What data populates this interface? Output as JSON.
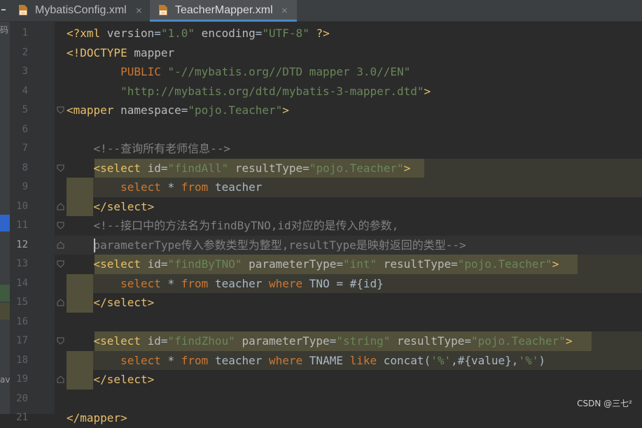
{
  "tabs": [
    {
      "label": "MybatisConfig.xml",
      "active": false,
      "close": "×"
    },
    {
      "label": "TeacherMapper.xml",
      "active": true,
      "close": "×"
    }
  ],
  "left_strip": {
    "text_top": "码",
    "text_bottom": "av"
  },
  "current_line": 12,
  "lines": [
    {
      "n": "1",
      "tokens": [
        [
          "tag",
          "<?xml "
        ],
        [
          "attr",
          "version"
        ],
        [
          "text",
          "="
        ],
        [
          "val",
          "\"1.0\""
        ],
        [
          "attr",
          " encoding"
        ],
        [
          "text",
          "="
        ],
        [
          "val",
          "\"UTF-8\""
        ],
        [
          "tag",
          " ?>"
        ]
      ]
    },
    {
      "n": "2",
      "tokens": [
        [
          "tag",
          "<!DOCTYPE "
        ],
        [
          "attr",
          "mapper"
        ]
      ]
    },
    {
      "n": "3",
      "tokens": [
        [
          "text",
          "        "
        ],
        [
          "pub",
          "PUBLIC "
        ],
        [
          "val",
          "\"-//mybatis.org//DTD mapper 3.0//EN\""
        ]
      ]
    },
    {
      "n": "4",
      "tokens": [
        [
          "text",
          "        "
        ],
        [
          "val",
          "\"http://mybatis.org/dtd/mybatis-3-mapper.dtd\""
        ],
        [
          "tag",
          ">"
        ]
      ]
    },
    {
      "n": "5",
      "tokens": [
        [
          "tag",
          "<mapper "
        ],
        [
          "attr",
          "namespace"
        ],
        [
          "text",
          "="
        ],
        [
          "val",
          "\"pojo.Teacher\""
        ],
        [
          "tag",
          ">"
        ]
      ]
    },
    {
      "n": "6",
      "tokens": []
    },
    {
      "n": "7",
      "tokens": [
        [
          "text",
          "    "
        ],
        [
          "com",
          "<!--查询所有老师信息-->"
        ]
      ]
    },
    {
      "n": "8",
      "tokens": [
        [
          "text",
          "    "
        ],
        [
          "tag",
          "<select "
        ],
        [
          "attr",
          "id"
        ],
        [
          "text",
          "="
        ],
        [
          "val",
          "\"findAll\""
        ],
        [
          "attr",
          " resultType"
        ],
        [
          "text",
          "="
        ],
        [
          "val",
          "\"pojo.Teacher\""
        ],
        [
          "tag",
          ">"
        ]
      ]
    },
    {
      "n": "9",
      "tokens": [
        [
          "text",
          "        "
        ],
        [
          "kw",
          "select "
        ],
        [
          "text",
          "* "
        ],
        [
          "kw",
          "from "
        ],
        [
          "text",
          "teacher"
        ]
      ]
    },
    {
      "n": "10",
      "tokens": [
        [
          "text",
          "    "
        ],
        [
          "tag",
          "</select>"
        ]
      ]
    },
    {
      "n": "11",
      "tokens": [
        [
          "text",
          "    "
        ],
        [
          "com",
          "<!--接口中的方法名为findByTNO,id对应的是传入的参数,"
        ]
      ]
    },
    {
      "n": "12",
      "tokens": [
        [
          "text",
          "    "
        ],
        [
          "com",
          "parameterType传入参数类型为整型,resultType是映射返回的类型-->"
        ]
      ]
    },
    {
      "n": "13",
      "tokens": [
        [
          "text",
          "    "
        ],
        [
          "tag",
          "<select "
        ],
        [
          "attr",
          "id"
        ],
        [
          "text",
          "="
        ],
        [
          "val",
          "\"findByTNO\""
        ],
        [
          "attr",
          " parameterType"
        ],
        [
          "text",
          "="
        ],
        [
          "val",
          "\"int\""
        ],
        [
          "attr",
          " resultType"
        ],
        [
          "text",
          "="
        ],
        [
          "val",
          "\"pojo.Teacher\""
        ],
        [
          "tag",
          ">"
        ]
      ]
    },
    {
      "n": "14",
      "tokens": [
        [
          "text",
          "        "
        ],
        [
          "kw",
          "select "
        ],
        [
          "text",
          "* "
        ],
        [
          "kw",
          "from "
        ],
        [
          "text",
          "teacher "
        ],
        [
          "kw",
          "where "
        ],
        [
          "text",
          "TNO = #{id}"
        ]
      ]
    },
    {
      "n": "15",
      "tokens": [
        [
          "text",
          "    "
        ],
        [
          "tag",
          "</select>"
        ]
      ]
    },
    {
      "n": "16",
      "tokens": []
    },
    {
      "n": "17",
      "tokens": [
        [
          "text",
          "    "
        ],
        [
          "tag",
          "<select "
        ],
        [
          "attr",
          "id"
        ],
        [
          "text",
          "="
        ],
        [
          "val",
          "\"findZhou\""
        ],
        [
          "attr",
          " parameterType"
        ],
        [
          "text",
          "="
        ],
        [
          "val",
          "\"string\""
        ],
        [
          "attr",
          " resultType"
        ],
        [
          "text",
          "="
        ],
        [
          "val",
          "\"pojo.Teacher\""
        ],
        [
          "tag",
          ">"
        ]
      ]
    },
    {
      "n": "18",
      "tokens": [
        [
          "text",
          "        "
        ],
        [
          "kw",
          "select "
        ],
        [
          "text",
          "* "
        ],
        [
          "kw",
          "from "
        ],
        [
          "text",
          "teacher "
        ],
        [
          "kw",
          "where "
        ],
        [
          "text",
          "TNAME "
        ],
        [
          "kw",
          "like "
        ],
        [
          "text",
          "concat("
        ],
        [
          "val",
          "'%'"
        ],
        [
          "text",
          ",#{value},"
        ],
        [
          "val",
          "'%'"
        ],
        [
          "text",
          ")"
        ]
      ]
    },
    {
      "n": "19",
      "tokens": [
        [
          "text",
          "    "
        ],
        [
          "tag",
          "</select>"
        ]
      ]
    },
    {
      "n": "20",
      "tokens": []
    },
    {
      "n": "21",
      "tokens": [
        [
          "tag",
          "</mapper>"
        ]
      ]
    }
  ],
  "watermark": "CSDN @三七²",
  "colors": {
    "tag": "#e8bf6a",
    "attr": "#bababa",
    "value": "#6a8759",
    "comment": "#808080",
    "keyword": "#cc7832",
    "background": "#2b2b2b"
  }
}
